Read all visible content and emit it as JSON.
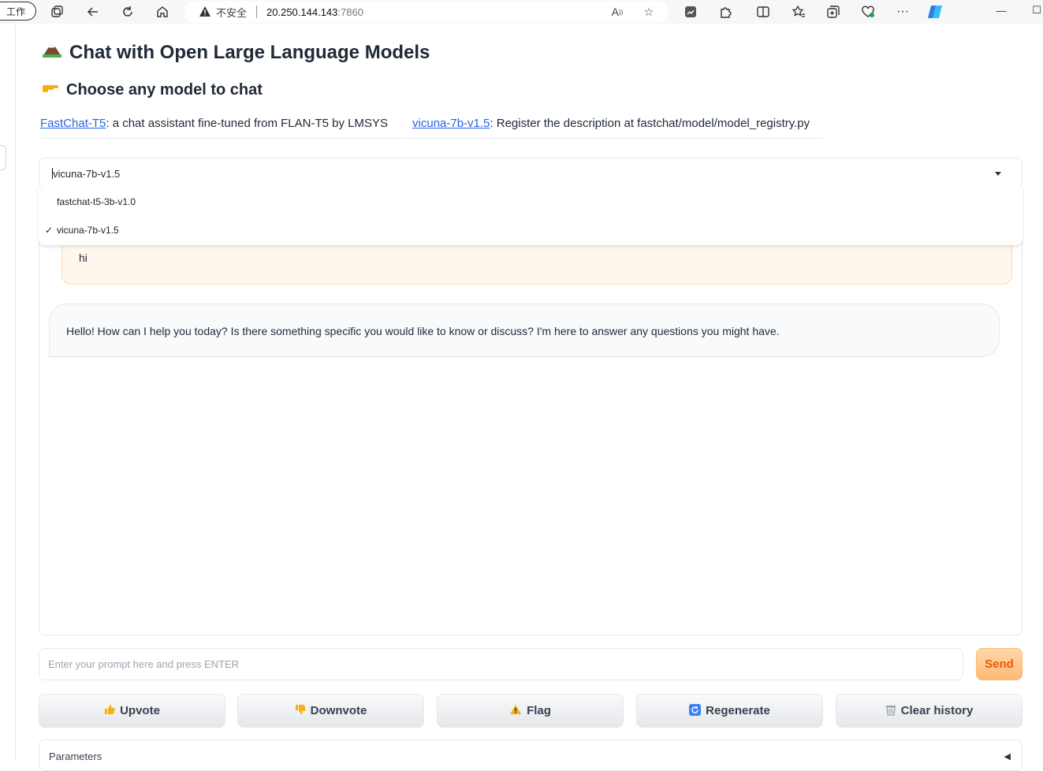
{
  "browser": {
    "profile_label": "工作",
    "address": {
      "security_label": "不安全",
      "host": "20.250.144.143",
      "port": ":7860"
    }
  },
  "page": {
    "title": "Chat with Open Large Language Models",
    "title_emoji": "🏔️",
    "subtitle": "Choose any model to chat",
    "subtitle_emoji": "👉",
    "models": [
      {
        "link": "FastChat-T5",
        "desc": ": a chat assistant fine-tuned from FLAN-T5 by LMSYS"
      },
      {
        "link": "vicuna-7b-v1.5",
        "desc": ": Register the description at fastchat/model/model_registry.py"
      }
    ],
    "model_select": {
      "value": "vicuna-7b-v1.5",
      "options": [
        {
          "label": "fastchat-t5-3b-v1.0",
          "selected": false
        },
        {
          "label": "vicuna-7b-v1.5",
          "selected": true
        }
      ],
      "check_mark": "✓"
    },
    "chat": {
      "user_message": "hi",
      "bot_message": "Hello! How can I help you today? Is there something specific you would like to know or discuss? I'm here to answer any questions you might have."
    },
    "prompt": {
      "placeholder": "Enter your prompt here and press ENTER",
      "value": ""
    },
    "send_label": "Send",
    "buttons": {
      "upvote": "Upvote",
      "downvote": "Downvote",
      "flag": "Flag",
      "regenerate": "Regenerate",
      "clear": "Clear history"
    },
    "parameters_label": "Parameters"
  },
  "colors": {
    "link": "#2563eb",
    "send_text": "#ea580c",
    "user_bubble": "#fff7ed",
    "bot_bubble": "#f9fafb"
  }
}
